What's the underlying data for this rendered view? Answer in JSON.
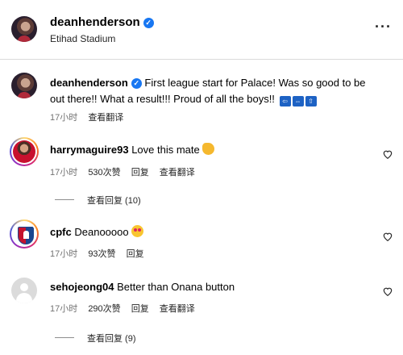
{
  "header": {
    "username": "deanhenderson",
    "location": "Etihad Stadium",
    "more_icon": "more-horizontal-icon"
  },
  "caption": {
    "username": "deanhenderson",
    "text": "First league start for Palace! Was so good to be out there!! What a result!!! Proud of all the boys!!",
    "emojis": [
      "BACK",
      "END",
      "TOP"
    ],
    "time": "17小时",
    "translate_label": "查看翻译"
  },
  "comments": [
    {
      "username": "harrymaguire93",
      "text": "Love this mate",
      "emoji": "clapping-hands",
      "time": "17小时",
      "likes": "530次赞",
      "reply_label": "回复",
      "translate_label": "查看翻译",
      "view_replies": "查看回复 (10)"
    },
    {
      "username": "cpfc",
      "text": "Deanooooo",
      "emoji": "heart-eyes",
      "time": "17小时",
      "likes": "93次赞",
      "reply_label": "回复"
    },
    {
      "username": "sehojeong04",
      "text": "Better than Onana button",
      "time": "17小时",
      "likes": "290次赞",
      "reply_label": "回复",
      "translate_label": "查看翻译",
      "view_replies": "查看回复 (9)"
    }
  ],
  "colors": {
    "verified": "#1877f2",
    "meta": "#737373",
    "divider": "#dbdbdb"
  }
}
